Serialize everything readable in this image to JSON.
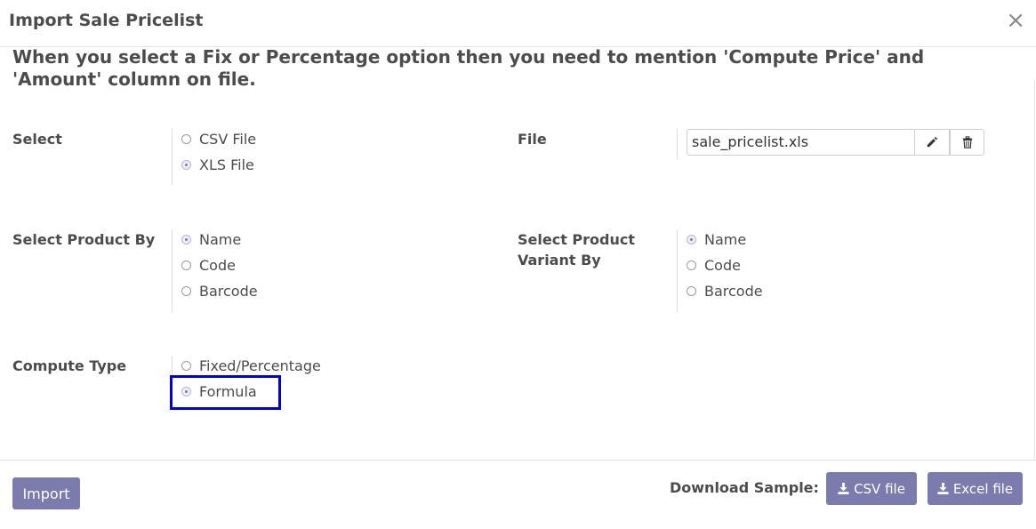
{
  "dialog": {
    "title": "Import Sale Pricelist",
    "close_symbol": "×"
  },
  "notice": "When you select a Fix or Percentage option then you need to mention 'Compute Price' and 'Amount' column on file.",
  "select": {
    "label": "Select",
    "options": [
      "CSV File",
      "XLS File"
    ],
    "selected": "XLS File"
  },
  "file": {
    "label": "File",
    "value": "sale_pricelist.xls",
    "edit_icon": "pencil-icon",
    "delete_icon": "trash-icon"
  },
  "product_by": {
    "label": "Select Product By",
    "options": [
      "Name",
      "Code",
      "Barcode"
    ],
    "selected": "Name"
  },
  "variant_by": {
    "label_line1": "Select Product",
    "label_line2": "Variant By",
    "options": [
      "Name",
      "Code",
      "Barcode"
    ],
    "selected": "Name"
  },
  "compute_type": {
    "label": "Compute Type",
    "options": [
      "Fixed/Percentage",
      "Formula"
    ],
    "selected": "Formula"
  },
  "footer": {
    "import_label": "Import",
    "download_label": "Download Sample:",
    "csv_label": "CSV file",
    "excel_label": "Excel file"
  },
  "colors": {
    "primary": "#7c7bad",
    "highlight": "#0000d8"
  }
}
